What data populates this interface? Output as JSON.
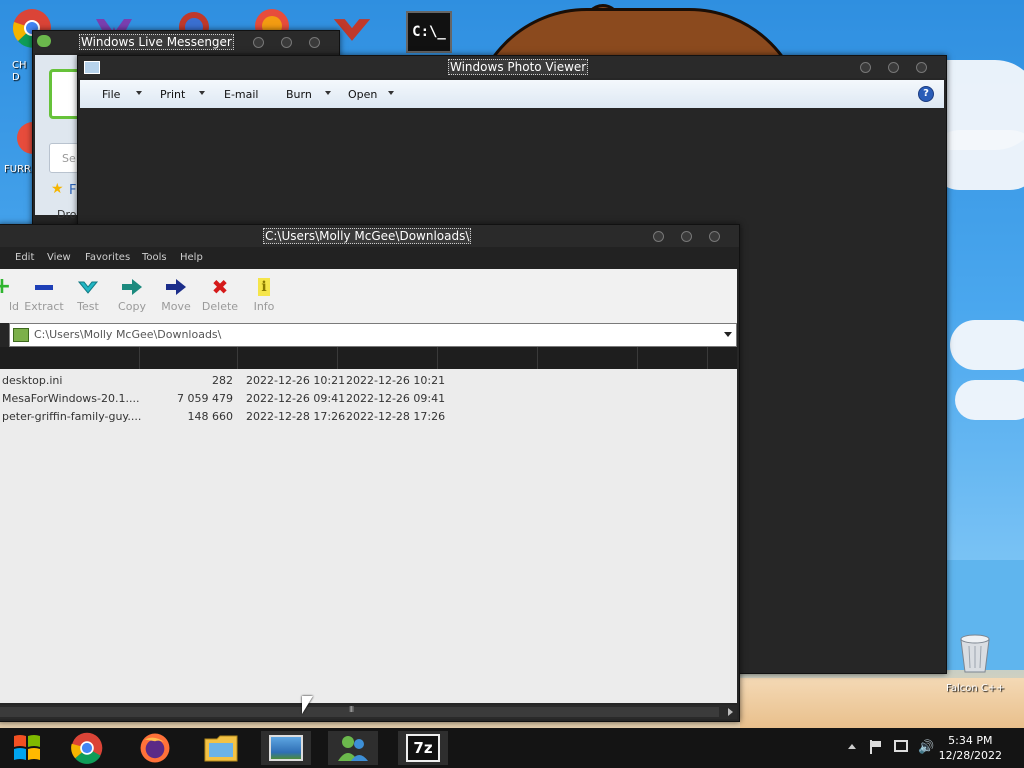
{
  "desktop": {
    "icons": [
      {
        "label": "CH D"
      },
      {
        "label": "FURR"
      },
      {
        "label": "Falcon C++"
      }
    ]
  },
  "messenger": {
    "title": "Windows Live Messenger",
    "search_placeholder": "Se",
    "favorite_text": "F",
    "drop_text": "Dro"
  },
  "photo_viewer": {
    "title": "Windows Photo Viewer",
    "menus": [
      "File",
      "Print",
      "E-mail",
      "Burn",
      "Open"
    ],
    "help": "?"
  },
  "sevenzip": {
    "title": "C:\\Users\\Molly McGee\\Downloads\\",
    "menus": [
      "Edit",
      "View",
      "Favorites",
      "Tools",
      "Help"
    ],
    "tools": [
      {
        "label": "ld",
        "icon": "add-icon",
        "color": "#2fb52f"
      },
      {
        "label": "Extract",
        "icon": "extract-icon",
        "color": "#1e3fb6"
      },
      {
        "label": "Test",
        "icon": "test-icon",
        "color": "#21b6c4"
      },
      {
        "label": "Copy",
        "icon": "copy-icon",
        "color": "#1c8a7e"
      },
      {
        "label": "Move",
        "icon": "move-icon",
        "color": "#1b2d8a"
      },
      {
        "label": "Delete",
        "icon": "delete-icon",
        "color": "#d51a1a"
      },
      {
        "label": "Info",
        "icon": "info-icon",
        "color": "#c7b000"
      }
    ],
    "address": "C:\\Users\\Molly McGee\\Downloads\\",
    "files": [
      {
        "name": "desktop.ini",
        "size": "282",
        "modified": "2022-12-26 10:21",
        "created": "2022-12-26 10:21"
      },
      {
        "name": "MesaForWindows-20.1....",
        "size": "7 059 479",
        "modified": "2022-12-26 09:41",
        "created": "2022-12-26 09:41"
      },
      {
        "name": "peter-griffin-family-guy....",
        "size": "148 660",
        "modified": "2022-12-28 17:26",
        "created": "2022-12-28 17:26"
      }
    ],
    "scroll_grip": "III"
  },
  "taskbar": {
    "buttons": [
      "start-button",
      "chrome",
      "firefox",
      "file-explorer",
      "photo-viewer",
      "messenger",
      "7zip"
    ],
    "sevenzip_label": "7z",
    "clock_time": "5:34 PM",
    "clock_date": "12/28/2022"
  },
  "colors": {
    "window_bg": "#262626",
    "list_bg": "#ececec",
    "accent_blue": "#2a5db8"
  }
}
